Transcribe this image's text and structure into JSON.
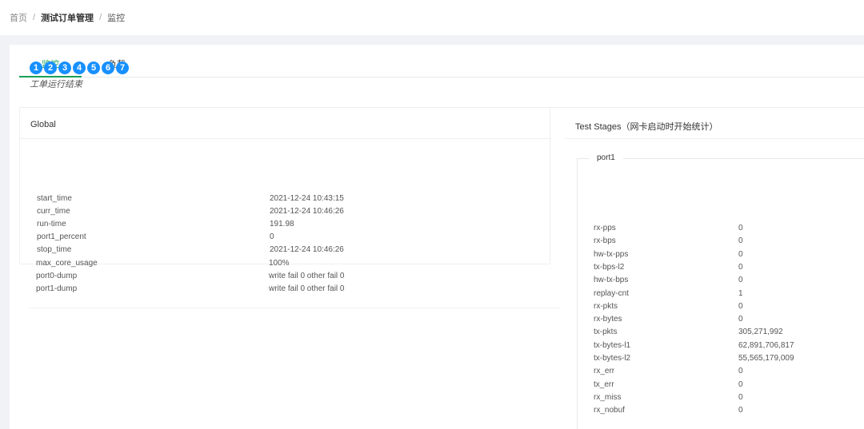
{
  "breadcrumb": {
    "home": "首页",
    "sep": "/",
    "order_mgmt": "测试订单管理",
    "current": "监控"
  },
  "tabs": [
    {
      "label": "监控",
      "active": true
    },
    {
      "label": "负载",
      "active": false
    }
  ],
  "steps": [
    "1",
    "2",
    "3",
    "4",
    "5",
    "6",
    "7"
  ],
  "status_text": "工单运行结束",
  "global": {
    "title": "Global",
    "rows": [
      {
        "key": "start_time",
        "value": "2021-12-24 10:43:15"
      },
      {
        "key": "curr_time",
        "value": "2021-12-24 10:46:26"
      },
      {
        "key": "run-time",
        "value": "191.98"
      },
      {
        "key": "port1_percent",
        "value": "0"
      },
      {
        "key": "stop_time",
        "value": "2021-12-24 10:46:26"
      },
      {
        "key": "max_core_usage",
        "value": "100%"
      },
      {
        "key": "port0-dump",
        "value": "write fail 0 other fail 0"
      },
      {
        "key": "port1-dump",
        "value": "write fail 0 other fail 0"
      }
    ]
  },
  "stages": {
    "title": "Test Stages（网卡启动时开始统计）",
    "port_legend": "port1",
    "rows": [
      {
        "key": "rx-pps",
        "value": "0"
      },
      {
        "key": "rx-bps",
        "value": "0"
      },
      {
        "key": "hw-tx-pps",
        "value": "0"
      },
      {
        "key": "tx-bps-l2",
        "value": "0"
      },
      {
        "key": "hw-tx-bps",
        "value": "0"
      },
      {
        "key": "replay-cnt",
        "value": "1"
      },
      {
        "key": "rx-pkts",
        "value": "0"
      },
      {
        "key": "rx-bytes",
        "value": "0"
      },
      {
        "key": "tx-pkts",
        "value": "305,271,992"
      },
      {
        "key": "tx-bytes-l1",
        "value": "62,891,706,817"
      },
      {
        "key": "tx-bytes-l2",
        "value": "55,565,179,009"
      },
      {
        "key": "rx_err",
        "value": "0"
      },
      {
        "key": "tx_err",
        "value": "0"
      },
      {
        "key": "rx_miss",
        "value": "0"
      },
      {
        "key": "rx_nobuf",
        "value": "0"
      }
    ]
  },
  "colors": {
    "accent": "#18a058",
    "step": "#1890ff"
  }
}
